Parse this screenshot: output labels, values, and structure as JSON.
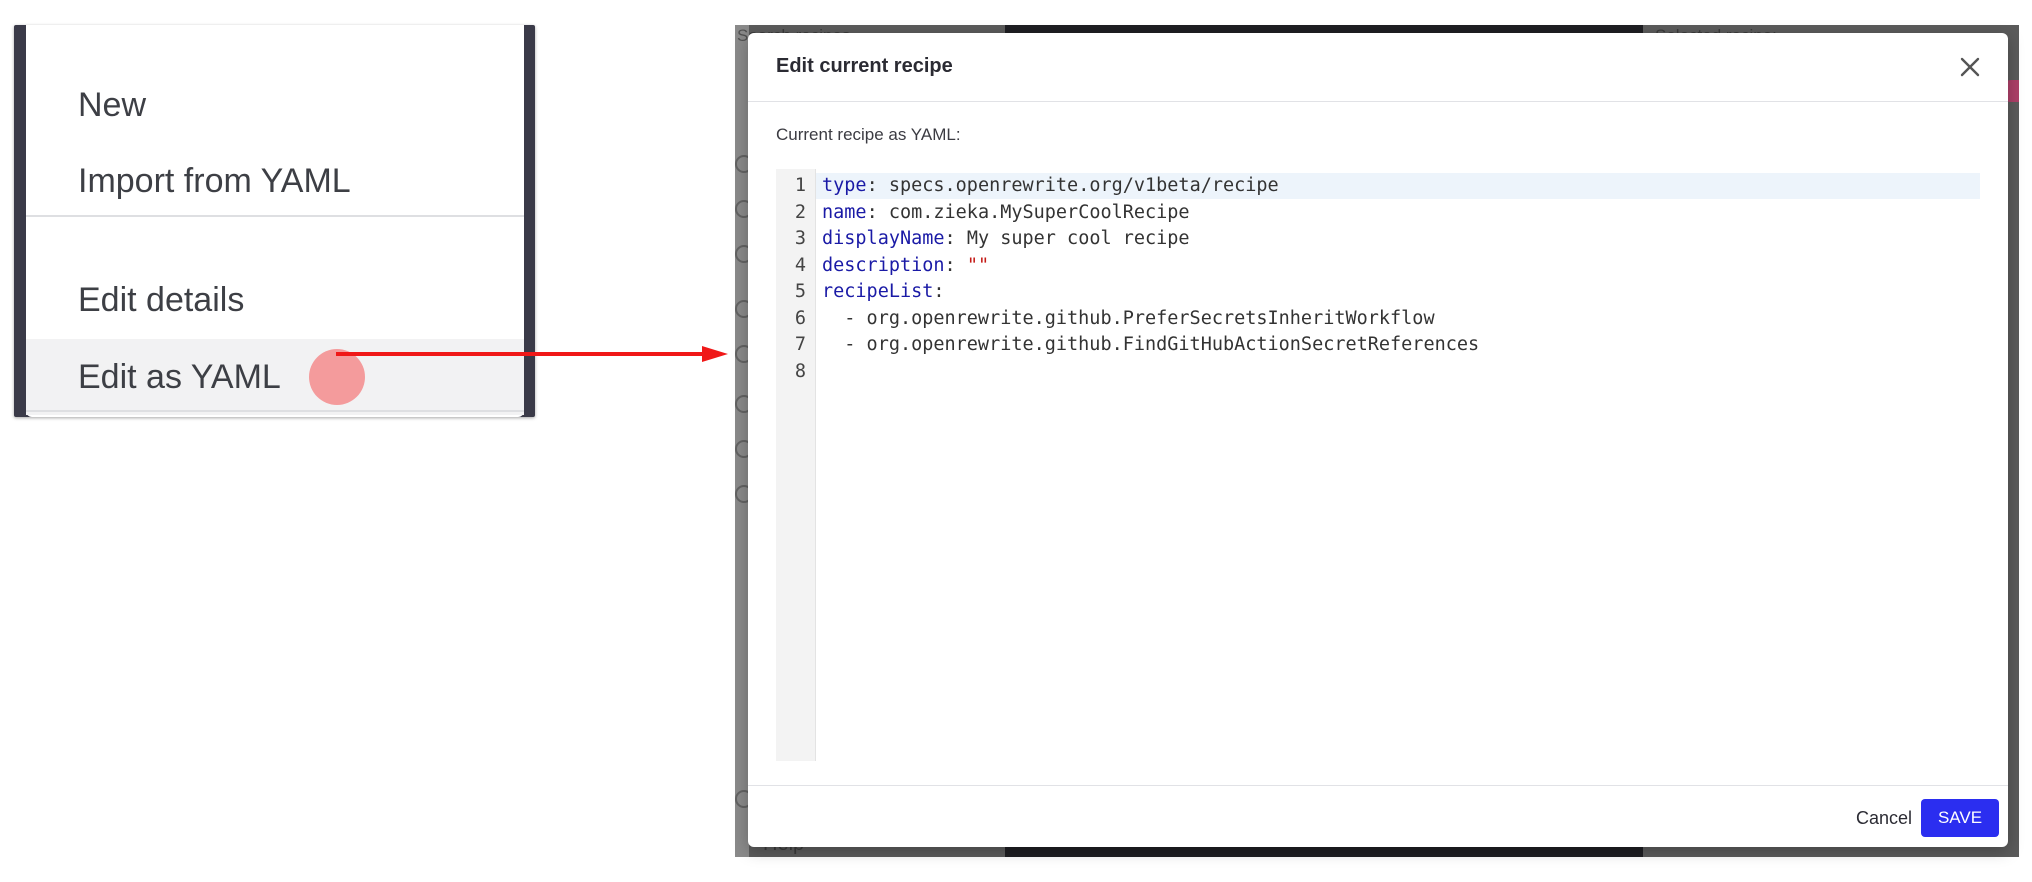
{
  "menu": {
    "items": [
      {
        "label": "New"
      },
      {
        "label": "Import from YAML"
      },
      {
        "label": "Edit details"
      },
      {
        "label": "Edit as YAML"
      }
    ]
  },
  "background": {
    "search_placeholder": "Search recipes",
    "selected_label": "Selected recipe:",
    "help_label": "Help"
  },
  "modal": {
    "title": "Edit current recipe",
    "yaml_label": "Current recipe as YAML:",
    "cancel_label": "Cancel",
    "save_label": "SAVE",
    "close_icon": "close-icon",
    "code_lines": [
      {
        "num": "1",
        "key": "type",
        "sep": ": ",
        "value": "specs.openrewrite.org/v1beta/recipe",
        "value_type": "plain"
      },
      {
        "num": "2",
        "key": "name",
        "sep": ": ",
        "value": "com.zieka.MySuperCoolRecipe",
        "value_type": "plain"
      },
      {
        "num": "3",
        "key": "displayName",
        "sep": ": ",
        "value": "My super cool recipe",
        "value_type": "plain"
      },
      {
        "num": "4",
        "key": "description",
        "sep": ": ",
        "value": "\"\"",
        "value_type": "string"
      },
      {
        "num": "5",
        "key": "recipeList",
        "sep": ":",
        "value": "",
        "value_type": "plain"
      },
      {
        "num": "6",
        "key": "",
        "sep": "",
        "value": "  - org.openrewrite.github.PreferSecretsInheritWorkflow",
        "value_type": "plain"
      },
      {
        "num": "7",
        "key": "",
        "sep": "",
        "value": "  - org.openrewrite.github.FindGitHubActionSecretReferences",
        "value_type": "plain"
      },
      {
        "num": "8",
        "key": "",
        "sep": "",
        "value": "",
        "value_type": "plain"
      }
    ]
  },
  "colors": {
    "accent": "#2b2ef0",
    "yaml_key": "#1a1aa6",
    "yaml_string": "#c41a16",
    "click_marker": "#f58c8c",
    "arrow": "#f01818"
  }
}
